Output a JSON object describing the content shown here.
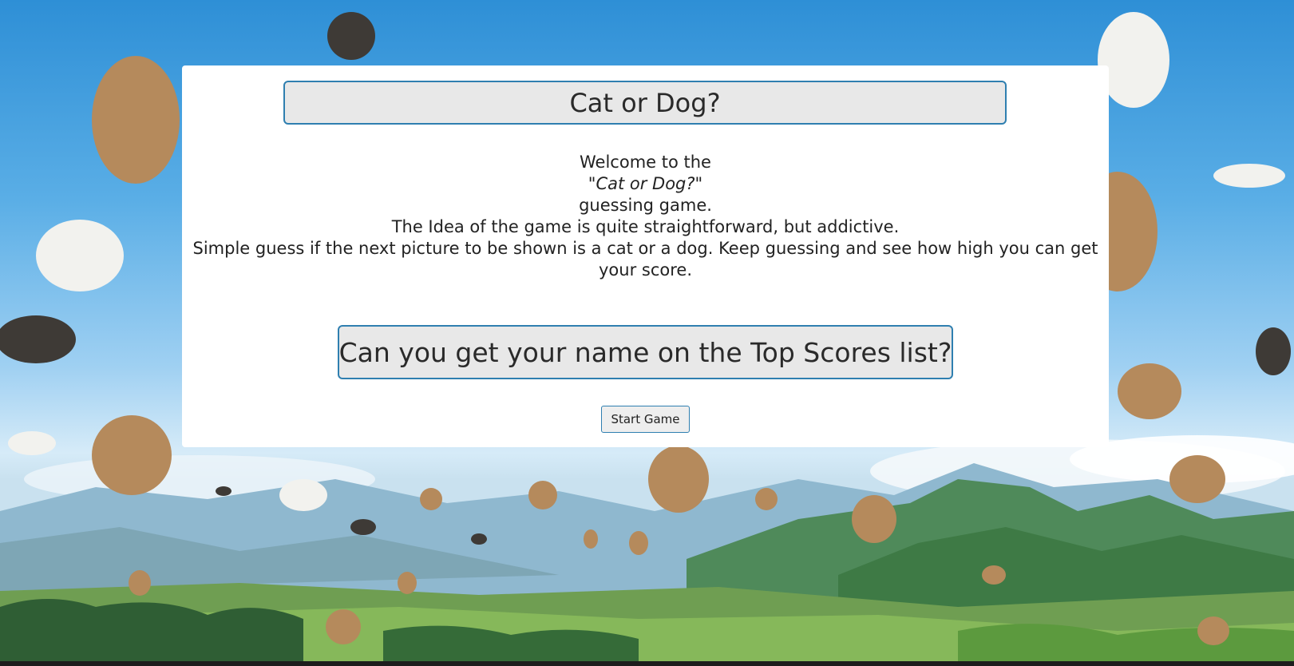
{
  "page": {
    "title": "Cat or Dog?",
    "intro_lines": [
      "Welcome to the",
      "\"Cat or Dog?\"",
      "guessing game.",
      "The Idea of the game is quite straightforward, but addictive.",
      "Simple guess if the next picture to be shown is a cat or a dog. Keep guessing and see how high you can get your score."
    ],
    "top_scores_prompt": "Can you get your name on the Top Scores list?",
    "start_button_label": "Start Game"
  },
  "colors": {
    "accent_border": "#2f7fb0",
    "box_fill": "#e8e8e8",
    "panel": "#ffffff",
    "text": "#222222"
  },
  "background": {
    "icon": "flying-cats-and-dogs-over-mountain-meadow"
  }
}
